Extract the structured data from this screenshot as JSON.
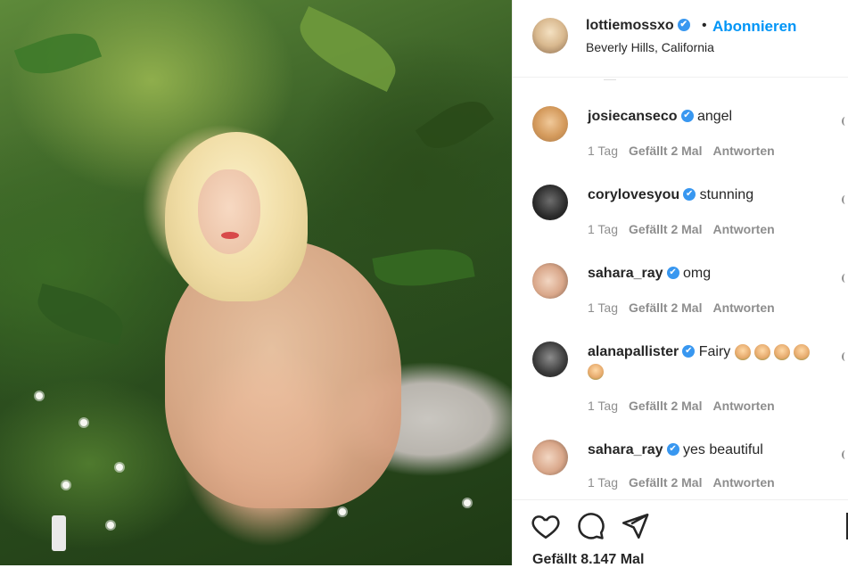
{
  "post": {
    "author": "lottiemossxo",
    "verified_mark": "✔",
    "separator": "•",
    "follow_label": "Abonnieren",
    "location": "Beverly Hills, California"
  },
  "comments": [
    {
      "user": "josiecanseco",
      "text": "angel",
      "time": "1 Tag",
      "likes": "Gefällt 2 Mal",
      "reply": "Antworten"
    },
    {
      "user": "corylovesyou",
      "text": "stunning",
      "time": "1 Tag",
      "likes": "Gefällt 2 Mal",
      "reply": "Antworten"
    },
    {
      "user": "sahara_ray",
      "text": "omg",
      "time": "1 Tag",
      "likes": "Gefällt 2 Mal",
      "reply": "Antworten"
    },
    {
      "user": "alanapallister",
      "text": "Fairy",
      "time": "1 Tag",
      "likes": "Gefällt 2 Mal",
      "reply": "Antworten"
    },
    {
      "user": "sahara_ray",
      "text": "yes beautiful",
      "time": "1 Tag",
      "likes": "Gefällt 2 Mal",
      "reply": "Antworten"
    }
  ],
  "footer": {
    "likes_count": "Gefällt 8.147 Mal"
  },
  "colors": {
    "accent": "#0095f6",
    "verified": "#3897f0",
    "meta": "#8e8e8e"
  },
  "icons": [
    "heart-icon",
    "comment-icon",
    "share-icon",
    "bookmark-icon",
    "verified-badge-icon",
    "fairy-emoji-icon"
  ]
}
